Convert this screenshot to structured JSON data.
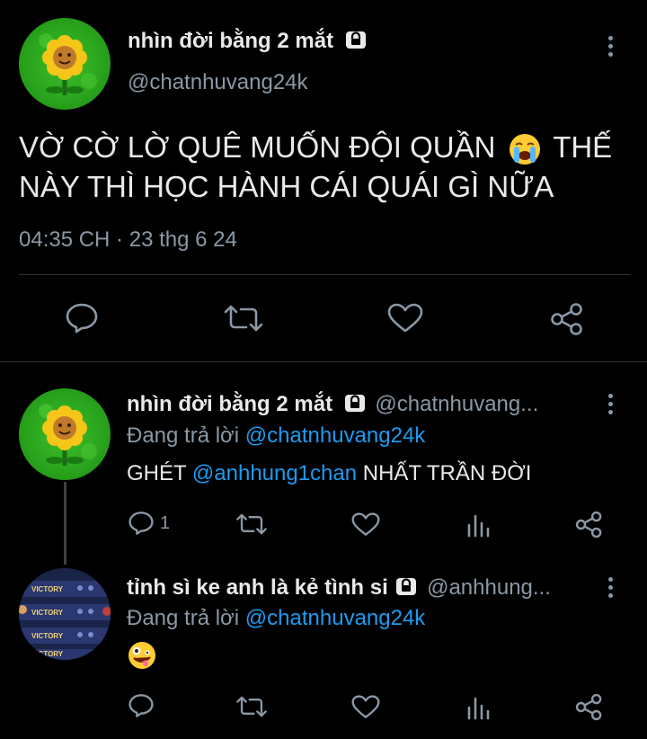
{
  "main_tweet": {
    "display_name": "nhìn đời bằng 2 mắt",
    "handle": "@chatnhuvang24k",
    "text": "VỜ CỜ LỜ QUÊ MUỐN ĐỘI QUẦN 😭 THẾ NÀY THÌ HỌC HÀNH CÁI QUÁI GÌ NỮA",
    "text_line1": "VỜ CỜ LỜ QUÊ MUỐN ĐỘI QUẦN",
    "text_line1_end": "THẾ",
    "text_line2": "NÀY THÌ HỌC HÀNH CÁI QUÁI GÌ NỮA",
    "timestamp": "04:35 CH · 23 thg 6 24"
  },
  "replies": [
    {
      "display_name": "nhìn đời bằng 2 mắt",
      "handle": "@chatnhuvang...",
      "replying_label": "Đang trả lời",
      "replying_to": "@chatnhuvang24k",
      "text_before": "GHÉT",
      "mention": "@anhhung1chan",
      "text_after": "NHẤT TRẦN ĐỜI",
      "reply_count": "1"
    },
    {
      "display_name": "tỉnh sì ke anh là kẻ tình si",
      "handle": "@anhhung...",
      "replying_label": "Đang trả lời",
      "replying_to": "@chatnhuvang24k",
      "text": "🤪",
      "avatar_text": "VICTORY"
    }
  ],
  "colors": {
    "background": "#000000",
    "text": "#e7e9ea",
    "secondary": "#8b98a5",
    "link": "#1d9bf0",
    "divider": "#2f3336"
  },
  "icons": [
    "lock-icon",
    "more-icon",
    "reply-icon",
    "retweet-icon",
    "like-icon",
    "share-icon",
    "views-icon"
  ]
}
